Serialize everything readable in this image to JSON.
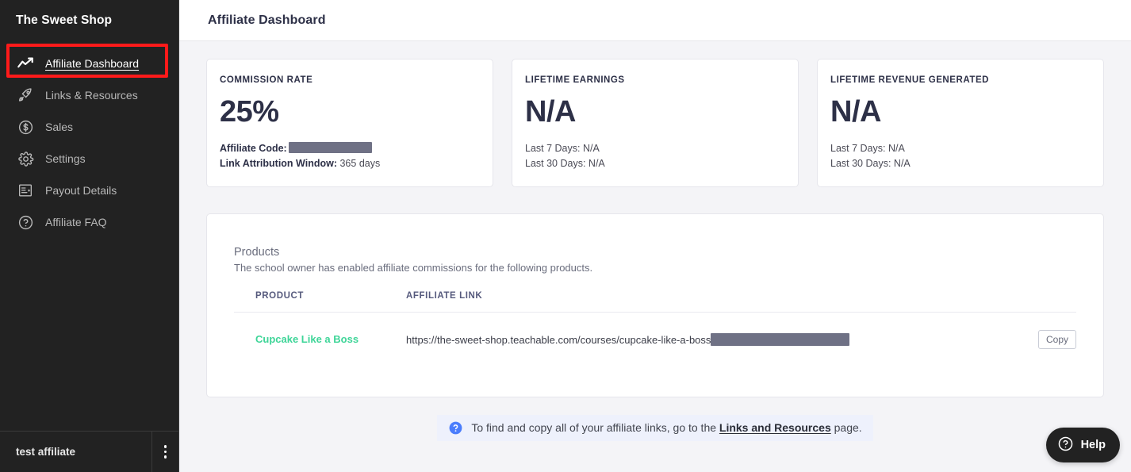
{
  "sidebar": {
    "brand": "The Sweet Shop",
    "items": [
      {
        "label": "Affiliate Dashboard",
        "icon": "trending-up-icon",
        "active": true
      },
      {
        "label": "Links & Resources",
        "icon": "rocket-icon",
        "active": false
      },
      {
        "label": "Sales",
        "icon": "dollar-circle-icon",
        "active": false
      },
      {
        "label": "Settings",
        "icon": "gear-icon",
        "active": false
      },
      {
        "label": "Payout Details",
        "icon": "receipt-icon",
        "active": false
      },
      {
        "label": "Affiliate FAQ",
        "icon": "question-circle-icon",
        "active": false
      }
    ],
    "user": "test affiliate",
    "menu_icon": "kebab-menu-icon"
  },
  "header": {
    "title": "Affiliate Dashboard"
  },
  "stats": [
    {
      "label": "COMMISSION RATE",
      "value": "25%",
      "line1_label": "Affiliate Code:",
      "line1_value": "",
      "line1_redacted": true,
      "line2_label": "Link Attribution Window:",
      "line2_value": "365 days"
    },
    {
      "label": "LIFETIME EARNINGS",
      "value": "N/A",
      "line1_label": "Last 7 Days:",
      "line1_value": "N/A",
      "line1_redacted": false,
      "line2_label": "Last 30 Days:",
      "line2_value": "N/A"
    },
    {
      "label": "LIFETIME REVENUE GENERATED",
      "value": "N/A",
      "line1_label": "Last 7 Days:",
      "line1_value": "N/A",
      "line1_redacted": false,
      "line2_label": "Last 30 Days:",
      "line2_value": "N/A"
    }
  ],
  "products": {
    "title": "Products",
    "description": "The school owner has enabled affiliate commissions for the following products.",
    "columns": [
      "PRODUCT",
      "AFFILIATE LINK"
    ],
    "rows": [
      {
        "product": "Cupcake Like a Boss",
        "link": "https://the-sweet-shop.teachable.com/courses/cupcake-like-a-boss",
        "link_redacted": true,
        "copy_label": "Copy"
      }
    ]
  },
  "note": {
    "icon": "question-circle-icon",
    "text_before": "To find and copy all of your affiliate links, go to the ",
    "link": "Links and Resources",
    "text_after": " page."
  },
  "help": {
    "label": "Help",
    "icon": "question-circle-icon"
  },
  "colors": {
    "sidebar_bg": "#222222",
    "content_bg": "#f4f4f7",
    "card_bg": "#ffffff",
    "accent_green": "#3ed598",
    "annotation_red": "#ff1a1a",
    "note_bg": "#eef1fc",
    "note_icon_blue": "#4a7dfc",
    "text_dark": "#2d3047",
    "redaction_gray": "#6f7185"
  }
}
